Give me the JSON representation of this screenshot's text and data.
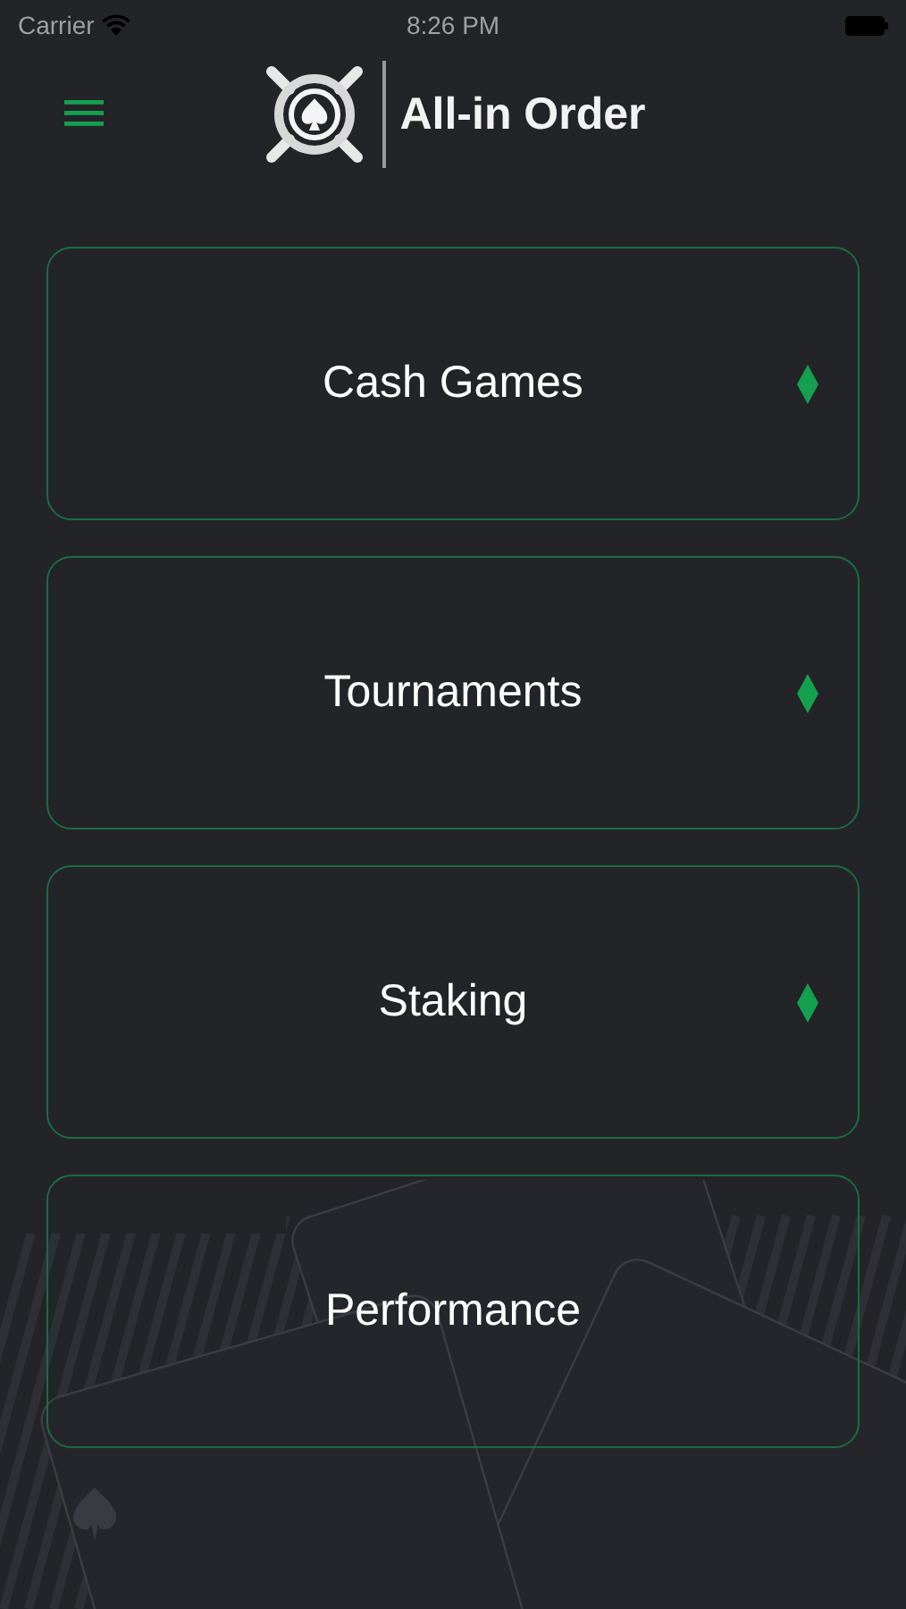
{
  "status_bar": {
    "carrier": "Carrier",
    "time": "8:26 PM"
  },
  "header": {
    "title": "All-in Order"
  },
  "menu_items": [
    {
      "label": "Cash Games",
      "diamond": true
    },
    {
      "label": "Tournaments",
      "diamond": true
    },
    {
      "label": "Staking",
      "diamond": true
    },
    {
      "label": "Performance",
      "diamond": false
    }
  ]
}
